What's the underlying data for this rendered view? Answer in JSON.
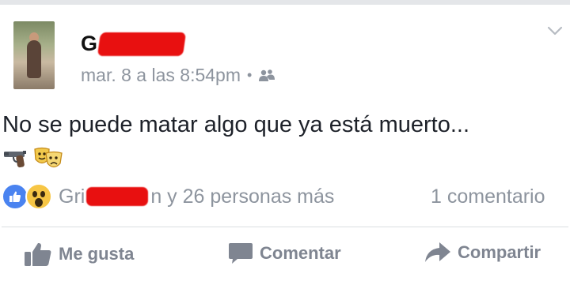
{
  "post": {
    "author_visible": "G",
    "meta_time": "mar. 8 a las 8:54pm",
    "meta_separator": "•",
    "privacy_icon": "friends-icon",
    "text": "No se puede matar algo que ya está muerto...",
    "emojis": [
      "🔫",
      "🎭"
    ]
  },
  "reactions": {
    "icons": [
      "like-icon",
      "wow-icon"
    ],
    "name_prefix": "Gri",
    "name_suffix": "n y 26 personas más",
    "comments_count": "1 comentario"
  },
  "actions": {
    "like_label": "Me gusta",
    "comment_label": "Comentar",
    "share_label": "Compartir"
  },
  "colors": {
    "redaction": "#e81010",
    "like_blue": "#4a83f0",
    "wow_yellow": "#f7c645",
    "muted_text": "#8d949e"
  }
}
